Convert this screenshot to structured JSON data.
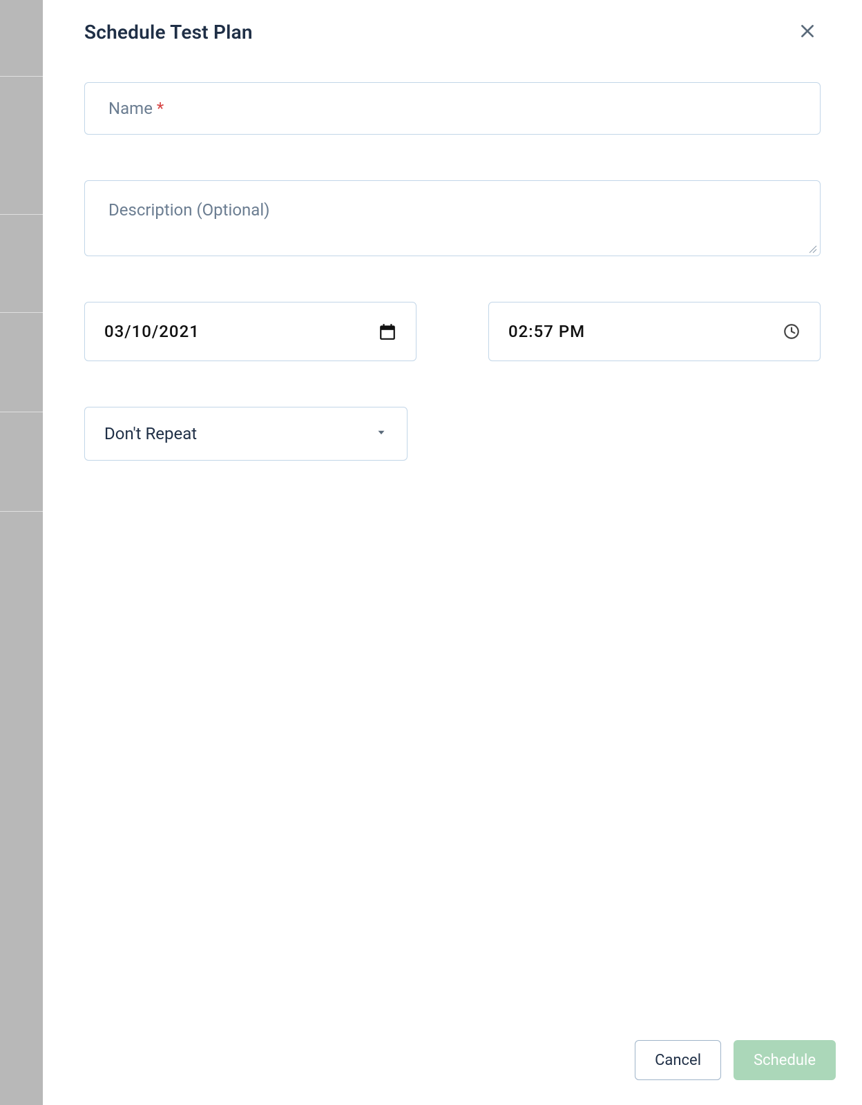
{
  "modal": {
    "title": "Schedule Test Plan",
    "name": {
      "placeholder": "Name",
      "required_mark": "*",
      "value": ""
    },
    "description": {
      "placeholder": "Description (Optional)",
      "value": ""
    },
    "date": {
      "value": "03/10/2021"
    },
    "time": {
      "value": "02:57 PM"
    },
    "repeat": {
      "selected": "Don't Repeat"
    },
    "actions": {
      "cancel": "Cancel",
      "schedule": "Schedule"
    }
  }
}
